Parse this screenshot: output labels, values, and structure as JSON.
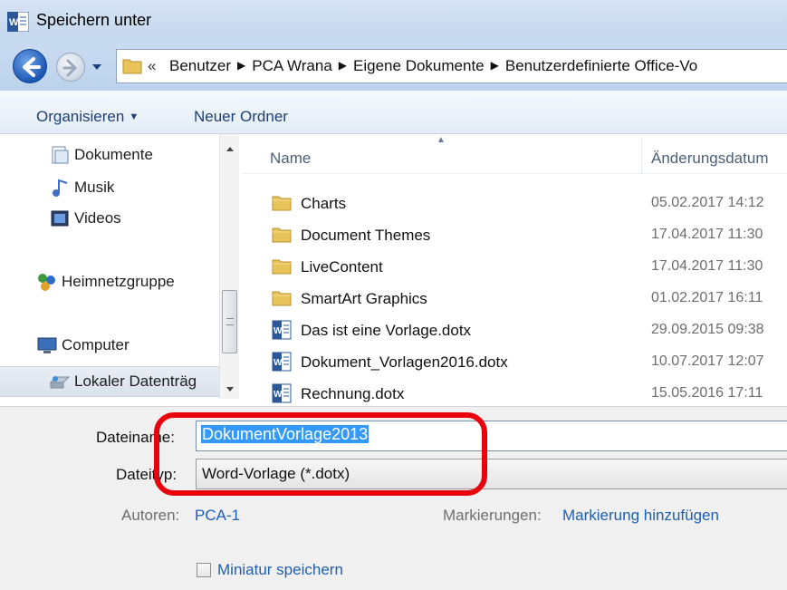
{
  "window": {
    "title": "Speichern unter"
  },
  "address": {
    "chevron": "«",
    "crumbs": [
      "Benutzer",
      "PCA Wrana",
      "Eigene Dokumente",
      "Benutzerdefinierte Office-Vo"
    ],
    "separator": "▶"
  },
  "toolbar": {
    "organize_label": "Organisieren",
    "new_folder_label": "Neuer Ordner"
  },
  "nav": {
    "items": [
      {
        "label": "Dokumente",
        "icon": "documents-library-icon"
      },
      {
        "label": "Musik",
        "icon": "music-library-icon"
      },
      {
        "label": "Videos",
        "icon": "videos-library-icon"
      },
      {
        "label": "Heimnetzgruppe",
        "icon": "homegroup-icon"
      },
      {
        "label": "Computer",
        "icon": "computer-icon"
      },
      {
        "label": "Lokaler Datenträg",
        "icon": "local-drive-icon",
        "selected": true
      }
    ]
  },
  "columns": {
    "name": "Name",
    "modified": "Änderungsdatum"
  },
  "files": [
    {
      "name": "Charts",
      "date": "05.02.2017 14:12",
      "type": "folder"
    },
    {
      "name": "Document Themes",
      "date": "17.04.2017 11:30",
      "type": "folder"
    },
    {
      "name": "LiveContent",
      "date": "17.04.2017 11:30",
      "type": "folder"
    },
    {
      "name": "SmartArt Graphics",
      "date": "01.02.2017 16:11",
      "type": "folder"
    },
    {
      "name": "Das ist eine Vorlage.dotx",
      "date": "29.09.2015 09:38",
      "type": "word"
    },
    {
      "name": "Dokument_Vorlagen2016.dotx",
      "date": "10.07.2017 12:07",
      "type": "word"
    },
    {
      "name": "Rechnung.dotx",
      "date": "15.05.2016 17:11",
      "type": "word"
    }
  ],
  "form": {
    "filename_label": "Dateiname:",
    "filename_value": "DokumentVorlage2013",
    "filetype_label": "Dateityp:",
    "filetype_value": "Word-Vorlage (*.dotx)",
    "authors_label": "Autoren:",
    "authors_value": "PCA-1",
    "tags_label": "Markierungen:",
    "tags_value": "Markierung hinzufügen",
    "thumbnail_label": "Miniatur speichern"
  },
  "colors": {
    "highlight": "#e8000d",
    "link": "#1f5fb0",
    "selection": "#3399ff"
  }
}
